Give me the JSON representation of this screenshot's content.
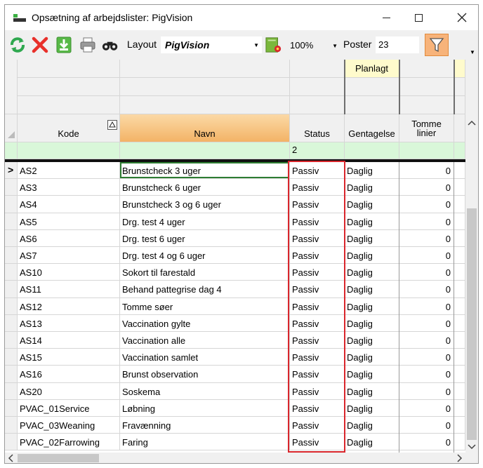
{
  "window": {
    "title": "Opsætning af arbejdslister: PigVision"
  },
  "toolbar": {
    "layout_label": "Layout",
    "layout_value": "PigVision",
    "zoom_value": "100%",
    "poster_label": "Poster",
    "poster_value": "23"
  },
  "grid": {
    "band_label": "Planlagt",
    "columns": [
      {
        "label": "Kode"
      },
      {
        "label": "Navn"
      },
      {
        "label": "Status"
      },
      {
        "label": "Gentagelse"
      },
      {
        "label": "Tomme\nlinier"
      }
    ],
    "filter_status_value": "2",
    "rows": [
      {
        "kode": "AS2",
        "navn": "Brunstcheck 3 uger",
        "status": "Passiv",
        "gentagelse": "Daglig",
        "tomme": "0"
      },
      {
        "kode": "AS3",
        "navn": "Brunstcheck 6 uger",
        "status": "Passiv",
        "gentagelse": "Daglig",
        "tomme": "0"
      },
      {
        "kode": "AS4",
        "navn": "Brunstcheck 3 og 6 uger",
        "status": "Passiv",
        "gentagelse": "Daglig",
        "tomme": "0"
      },
      {
        "kode": "AS5",
        "navn": "Drg. test 4 uger",
        "status": "Passiv",
        "gentagelse": "Daglig",
        "tomme": "0"
      },
      {
        "kode": "AS6",
        "navn": "Drg. test 6 uger",
        "status": "Passiv",
        "gentagelse": "Daglig",
        "tomme": "0"
      },
      {
        "kode": "AS7",
        "navn": "Drg. test 4 og 6 uger",
        "status": "Passiv",
        "gentagelse": "Daglig",
        "tomme": "0"
      },
      {
        "kode": "AS10",
        "navn": "Sokort til farestald",
        "status": "Passiv",
        "gentagelse": "Daglig",
        "tomme": "0"
      },
      {
        "kode": "AS11",
        "navn": "Behand pattegrise dag 4",
        "status": "Passiv",
        "gentagelse": "Daglig",
        "tomme": "0"
      },
      {
        "kode": "AS12",
        "navn": "Tomme søer",
        "status": "Passiv",
        "gentagelse": "Daglig",
        "tomme": "0"
      },
      {
        "kode": "AS13",
        "navn": "Vaccination gylte",
        "status": "Passiv",
        "gentagelse": "Daglig",
        "tomme": "0"
      },
      {
        "kode": "AS14",
        "navn": "Vaccination alle",
        "status": "Passiv",
        "gentagelse": "Daglig",
        "tomme": "0"
      },
      {
        "kode": "AS15",
        "navn": "Vaccination samlet",
        "status": "Passiv",
        "gentagelse": "Daglig",
        "tomme": "0"
      },
      {
        "kode": "AS16",
        "navn": "Brunst observation",
        "status": "Passiv",
        "gentagelse": "Daglig",
        "tomme": "0"
      },
      {
        "kode": "AS20",
        "navn": "Soskema",
        "status": "Passiv",
        "gentagelse": "Daglig",
        "tomme": "0"
      },
      {
        "kode": "PVAC_01Service",
        "navn": "Løbning",
        "status": "Passiv",
        "gentagelse": "Daglig",
        "tomme": "0"
      },
      {
        "kode": "PVAC_03Weaning",
        "navn": "Fravænning",
        "status": "Passiv",
        "gentagelse": "Daglig",
        "tomme": "0"
      },
      {
        "kode": "PVAC_02Farrowing",
        "navn": "Faring",
        "status": "Passiv",
        "gentagelse": "Daglig",
        "tomme": "0"
      }
    ]
  },
  "colors": {
    "header_sorted": "#f6c27a",
    "band_bg": "#fffbcc",
    "filter_row": "#d9f7d9",
    "highlight_box": "#d9262c",
    "filter_button": "#f7b37a"
  }
}
